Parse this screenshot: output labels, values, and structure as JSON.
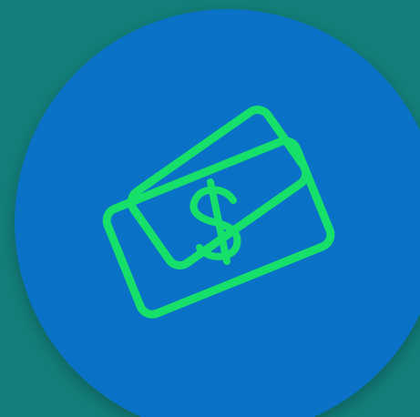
{
  "colors": {
    "page_background": "#137f7a",
    "circle_fill": "#0a72c6",
    "icon_stroke": "#16e06a"
  },
  "icon": {
    "name": "money-bills-icon",
    "symbol": "$"
  }
}
